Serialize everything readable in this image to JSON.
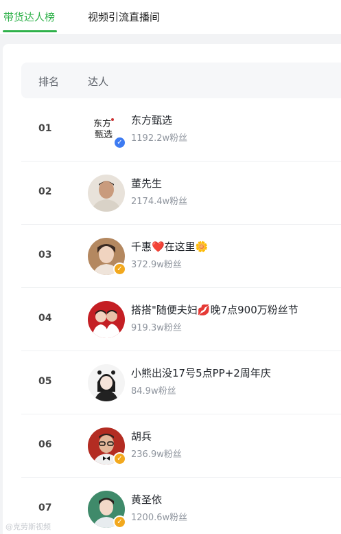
{
  "tabs": [
    {
      "label": "带货达人榜"
    },
    {
      "label": "视频引流直播间"
    }
  ],
  "table": {
    "headers": {
      "rank": "排名",
      "person": "达人"
    },
    "rows": [
      {
        "rank": "01",
        "name": "东方甄选",
        "fans": "1192.2w粉丝",
        "avatar_text": "东方甄选",
        "badge": "blue"
      },
      {
        "rank": "02",
        "name": "董先生",
        "fans": "2174.4w粉丝",
        "avatar_text": "",
        "badge": ""
      },
      {
        "rank": "03",
        "name": "千惠❤️在这里🌼",
        "fans": "372.9w粉丝",
        "avatar_text": "",
        "badge": "gold"
      },
      {
        "rank": "04",
        "name": "搭搭\"随便夫妇💋晚7点900万粉丝节",
        "fans": "919.3w粉丝",
        "avatar_text": "",
        "badge": ""
      },
      {
        "rank": "05",
        "name": "小熊出没17号5点PP+2周年庆",
        "fans": "84.9w粉丝",
        "avatar_text": "",
        "badge": ""
      },
      {
        "rank": "06",
        "name": "胡兵",
        "fans": "236.9w粉丝",
        "avatar_text": "",
        "badge": "gold"
      },
      {
        "rank": "07",
        "name": "黄圣依",
        "fans": "1200.6w粉丝",
        "avatar_text": "",
        "badge": "gold"
      }
    ]
  },
  "watermark": "@克劳斯视频",
  "colors": {
    "accent": "#2fb14a"
  }
}
